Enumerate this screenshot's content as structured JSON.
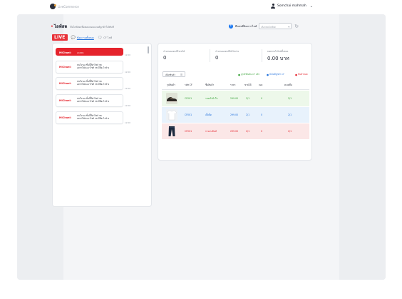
{
  "brand": {
    "name": "LiveCommerce",
    "logo_icon": "brand-logo-icon"
  },
  "user": {
    "name": "Somchai mahmah",
    "icon": "user-icon",
    "menu_icon": "chevron-down-icon"
  },
  "page": {
    "title": "ไลฟ์สด",
    "subtitle": "ดึงไลฟ์สดเพื่อตอบคอมเมนต์ลูกค้าได้ทันที"
  },
  "facebook": {
    "label": "ดึงเพจที่ต้องการไลฟ์",
    "select_placeholder": "เลือกเพจไลฟ์สด",
    "icon": "facebook-icon",
    "refresh_icon": "refresh-icon"
  },
  "tabs": {
    "live_label": "LIVE",
    "items": [
      {
        "label": "ข้อความทั้งหมด",
        "icon": "chat-icon",
        "active": true
      },
      {
        "label": "CF ไลฟ์",
        "icon": "comment-icon",
        "active": false
      }
    ]
  },
  "chat": {
    "items": [
      {
        "name": "MiChael:",
        "message": "A1001",
        "time": "12:00",
        "highlight": true
      },
      {
        "name": "MiChael:",
        "message": "สนใจรอง ชิ้นนี้สีดำไซส์ 38\nอยากได้ค่ะเอาไซส์ 38 มีสีอะไรบ้าง",
        "time": "12:00",
        "highlight": false
      },
      {
        "name": "MiChael:",
        "message": "สนใจรอง ชิ้นนี้สีดำไซส์ 38\nอยากได้ค่ะเอาไซส์ 38 มีสีอะไรบ้าง",
        "time": "12:00",
        "highlight": false
      },
      {
        "name": "MiChael:",
        "message": "สนใจรอง ชิ้นนี้สีดำไซส์ 38\nอยากได้ค่ะเอาไซส์ 38 มีสีอะไรบ้าง",
        "time": "12:00",
        "highlight": false
      },
      {
        "name": "MiChael:",
        "message": "สนใจรอง ชิ้นนี้สีดำไซส์ 38\nอยากได้ค่ะเอาไซส์ 38 มีสีอะไรบ้าง",
        "time": "12:00",
        "highlight": false
      }
    ]
  },
  "stats": [
    {
      "label": "จำนวนออเดอร์ที่ขายได้",
      "value": "0"
    },
    {
      "label": "จำนวนออเดอร์ที่ยังไม่จ่าย",
      "value": "0"
    },
    {
      "label": "ยอดขายในไลฟ์ทั้งหมด",
      "value": "0.00 บาท"
    }
  ],
  "table": {
    "filter_label": "เลือกสินค้า",
    "filter_icon": "list-icon",
    "legend": [
      {
        "label": "ลูกค้ายืนยัน CF แล้ว",
        "color": "#3aa33a"
      },
      {
        "label": "ยังไม่มีลูกค้า CF",
        "color": "#1f6fdb"
      },
      {
        "label": "สินค้าหมด",
        "color": "#e5232c"
      }
    ],
    "headers": [
      "รูปสินค้า",
      "รหัส CF",
      "ชื่อสินค้า",
      "ราคา",
      "ขายได้",
      "จอง",
      "คงเหลือ"
    ],
    "rows": [
      {
        "status": "green",
        "image": "shoe-image",
        "code": "CF001",
        "name": "รองเท้าผ้าใบ",
        "price": "299.00",
        "sold": "2/1",
        "reserved": "0",
        "remaining": "2/1"
      },
      {
        "status": "blue",
        "image": "tshirt-image",
        "code": "CF001",
        "name": "เสื้อยืด",
        "price": "299.00",
        "sold": "2/1",
        "reserved": "0",
        "remaining": "2/1"
      },
      {
        "status": "red",
        "image": "jeans-image",
        "code": "CF001",
        "name": "กางเกงยีนส์",
        "price": "299.00",
        "sold": "2/1",
        "reserved": "0",
        "remaining": "2/1"
      }
    ]
  }
}
